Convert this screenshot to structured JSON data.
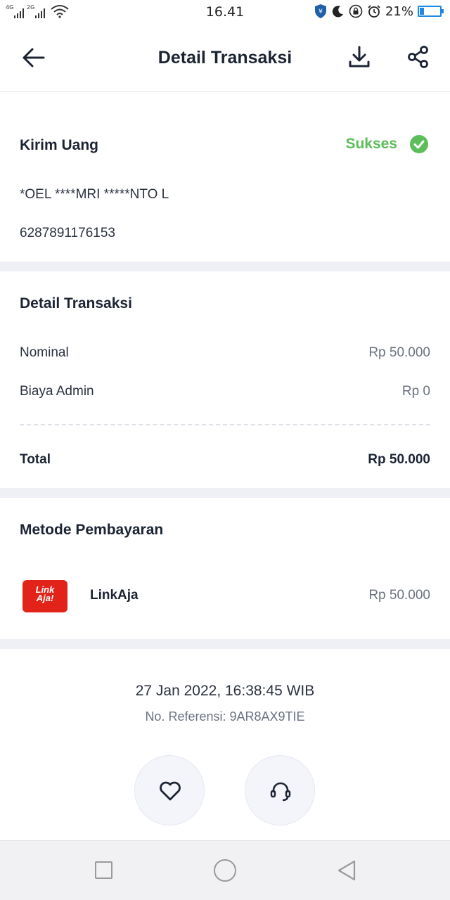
{
  "status_bar": {
    "network_1": "4G",
    "network_2": "2G",
    "time": "16.41",
    "battery_percent": "21%",
    "battery_level": 0.21,
    "icons": [
      "wifi-icon",
      "shield-icon",
      "moon-icon",
      "lock-icon",
      "alarm-icon",
      "battery-icon"
    ]
  },
  "header": {
    "title": "Detail Transaksi",
    "icons": [
      "back-arrow-icon",
      "download-icon",
      "share-icon"
    ]
  },
  "transfer": {
    "type": "Kirim Uang",
    "status": "Sukses",
    "recipient_name": "*OEL ****MRI *****NTO L",
    "recipient_number": "6287891176153"
  },
  "details": {
    "title": "Detail Transaksi",
    "nominal_label": "Nominal",
    "nominal_value": "Rp 50.000",
    "admin_label": "Biaya Admin",
    "admin_value": "Rp 0",
    "total_label": "Total",
    "total_value": "Rp 50.000"
  },
  "payment": {
    "title": "Metode Pembayaran",
    "logo_line1": "Link",
    "logo_line2": "Aja!",
    "method": "LinkAja",
    "amount": "Rp 50.000"
  },
  "meta": {
    "datetime": "27 Jan 2022, 16:38:45 WIB",
    "reference": "No. Referensi: 9AR8AX9TIE"
  },
  "actions": {
    "icons": [
      "heart-icon",
      "headset-icon"
    ]
  },
  "colors": {
    "success": "#5cbe5a",
    "brand_red": "#e2231a",
    "section_gap": "#eef0f5",
    "text_dark": "#1c2434"
  }
}
